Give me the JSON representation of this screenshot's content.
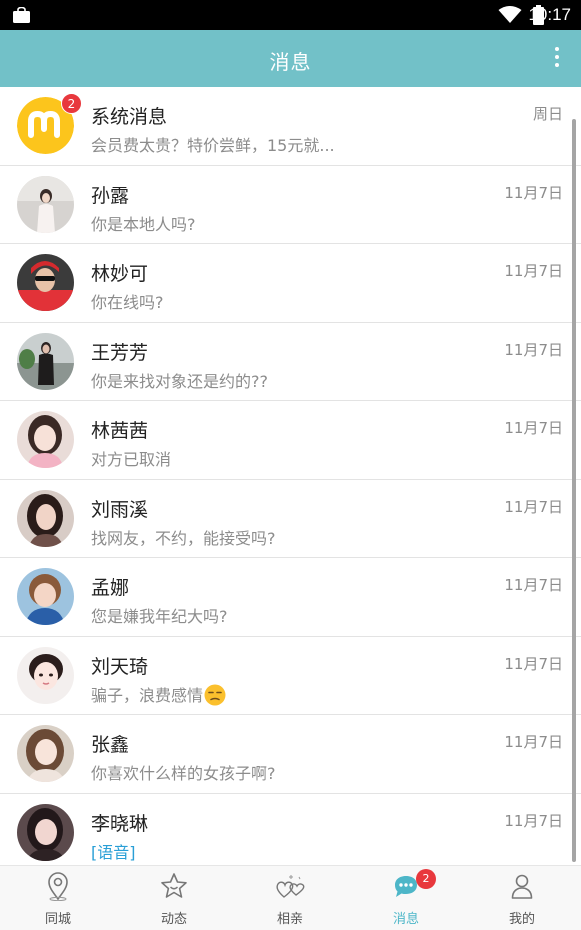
{
  "status_bar": {
    "time": "10:17"
  },
  "app_bar": {
    "title": "消息"
  },
  "messages": [
    {
      "name": "系统消息",
      "preview": "会员费太贵？特价尝鲜，15元就...",
      "date": "周日",
      "badge": "2"
    },
    {
      "name": "孙露",
      "preview": "你是本地人吗?",
      "date": "11月7日"
    },
    {
      "name": "林妙可",
      "preview": "你在线吗?",
      "date": "11月7日"
    },
    {
      "name": "王芳芳",
      "preview": "你是来找对象还是约的??",
      "date": "11月7日"
    },
    {
      "name": "林茜茜",
      "preview": "对方已取消",
      "date": "11月7日"
    },
    {
      "name": "刘雨溪",
      "preview": "找网友，不约，能接受吗?",
      "date": "11月7日"
    },
    {
      "name": "孟娜",
      "preview": "您是嫌我年纪大吗?",
      "date": "11月7日"
    },
    {
      "name": "刘天琦",
      "preview": "骗子，浪费感情",
      "date": "11月7日"
    },
    {
      "name": "张鑫",
      "preview": "你喜欢什么样的女孩子啊?",
      "date": "11月7日"
    },
    {
      "name": "李晓琳",
      "preview": "[语音]",
      "date": "11月7日"
    }
  ],
  "tabs": [
    {
      "label": "同城",
      "icon": "location-pin-icon"
    },
    {
      "label": "动态",
      "icon": "star-icon"
    },
    {
      "label": "相亲",
      "icon": "hearts-icon"
    },
    {
      "label": "消息",
      "icon": "chat-bubble-icon",
      "badge": "2",
      "active": true
    },
    {
      "label": "我的",
      "icon": "person-icon"
    }
  ],
  "colors": {
    "app_bar": "#72c1c8",
    "badge": "#e8383d",
    "active_tab": "#4db6c8",
    "voice_text": "#2a9fd6"
  }
}
